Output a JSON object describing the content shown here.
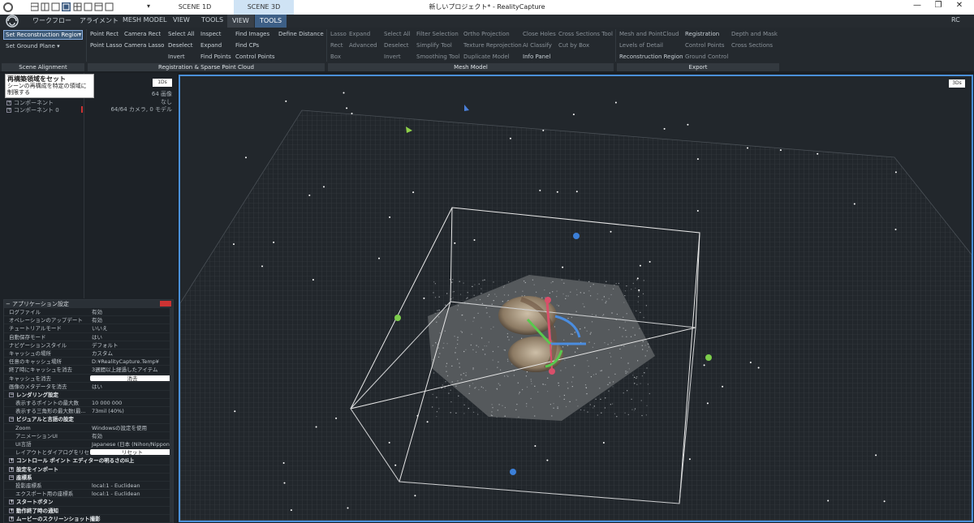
{
  "window": {
    "title": "新しいプロジェクト* - RealityCapture",
    "user": "RC",
    "minimize": "—",
    "maximize": "❐",
    "close": "✕"
  },
  "scene_tabs": [
    "SCENE 1D",
    "SCENE 3D"
  ],
  "menu": {
    "items": [
      "ワークフロー",
      "アライメント",
      "MESH MODEL",
      "VIEW",
      "TOOLS"
    ],
    "view": "VIEW",
    "tools": "TOOLS"
  },
  "ribbon": {
    "scene_alignment": {
      "caption": "Scene Alignment",
      "dropdown": "Set Reconstruction Region",
      "ground": "Set Ground Plane"
    },
    "registration": {
      "caption": "Registration & Sparse Point Cloud",
      "col1": [
        "Point Rect",
        "Point Lasso"
      ],
      "col2": [
        "Camera Rect",
        "Camera Lasso"
      ],
      "col3": [
        "Select All",
        "Deselect",
        "Invert"
      ],
      "col4": [
        "Inspect",
        "Expand",
        "Find Points"
      ],
      "col5": [
        "Find Images",
        "Find CPs",
        "Control Points"
      ],
      "col6": [
        "Define Distance"
      ]
    },
    "mesh": {
      "caption": "Mesh Model",
      "col1": [
        "Lasso",
        "Rect",
        "Box"
      ],
      "col2": [
        "Expand",
        "Advanced"
      ],
      "col3": [
        "Select All",
        "Deselect",
        "Invert"
      ],
      "col4": [
        "Filter Selection",
        "Simplify Tool",
        "Smoothing Tool"
      ],
      "col5": [
        "Ortho Projection",
        "Texture Reprojection",
        "Duplicate Model"
      ],
      "col6": [
        "Close Holes",
        "AI Classify",
        "Info Panel"
      ],
      "col7": [
        "Cross Sections Tool",
        "Cut by Box"
      ]
    },
    "export": {
      "caption": "Export",
      "col1": [
        "Mesh and PointCloud",
        "Levels of Detail",
        "Reconstruction Region"
      ],
      "col2": [
        "Registration",
        "Control Points",
        "Ground Control"
      ],
      "col3": [
        "Depth and Mask",
        "Cross Sections"
      ]
    }
  },
  "tooltip": {
    "title": "再構築領域をセット",
    "body": "シーンの再構成を特定の領域に制限する"
  },
  "tree": {
    "rows": [
      "コンポーネント",
      "コンポーネント 0"
    ]
  },
  "info": {
    "badge": "1Ds",
    "rows": [
      "64 画像",
      "なし",
      "64/64 カメラ, 0 モデル"
    ]
  },
  "settings": {
    "title": "アプリケーション設定",
    "rows": [
      {
        "k": "ログファイル",
        "v": "有効"
      },
      {
        "k": "オペレーションのアップデート",
        "v": "有効"
      },
      {
        "k": "チュートリアルモード",
        "v": "いいえ"
      },
      {
        "k": "自動保存モード",
        "v": "はい"
      },
      {
        "k": "ナビゲーションスタイル",
        "v": "デフォルト"
      },
      {
        "k": "キャッシュの場所",
        "v": "カスタム"
      },
      {
        "k": "任意のキャッシュ場所",
        "v": "D:¥RealityCapture.Temp¥"
      },
      {
        "k": "終了時にキャッシュを消去",
        "v": "3週間以上経過したアイテム"
      },
      {
        "k": "キャッシュを消去",
        "v": "消去",
        "btn": true
      },
      {
        "k": "画像のメタデータを消去",
        "v": "はい"
      },
      {
        "k": "レンダリング設定",
        "sec": true
      },
      {
        "k": "表示するポイントの最大数",
        "v": "10 000 000",
        "sub": true
      },
      {
        "k": "表示する三角形の最大数(最...",
        "v": "73mil (40%)",
        "sub": true
      },
      {
        "k": "ビジュアルと言語の設定",
        "sec": true
      },
      {
        "k": "Zoom",
        "v": "Windowsの設定を使用",
        "sub": true
      },
      {
        "k": "アニメーションUI",
        "v": "有効",
        "sub": true
      },
      {
        "k": "UI言語",
        "v": "Japanese (日本 (Nihon/Nippon))",
        "sub": true
      },
      {
        "k": "レイアウトとダイアログをリセット",
        "v": "リセット",
        "btn": true,
        "sub": true
      },
      {
        "k": "コントロール ポイント エディターの明るさのIi上",
        "sec": true
      },
      {
        "k": "設定をインポート",
        "sec": true
      },
      {
        "k": "座標系",
        "sec": true
      },
      {
        "k": "投影座標系",
        "v": "local:1 - Euclidean",
        "sub": true
      },
      {
        "k": "エクスポート用の座標系",
        "v": "local:1 - Euclidean",
        "sub": true
      },
      {
        "k": "スタートボタン",
        "sec": true
      },
      {
        "k": "動作終了時の通知",
        "sec": true
      },
      {
        "k": "ムービーのスクリーンショット撮影",
        "sec": true
      }
    ]
  },
  "viewport": {
    "badge": "3Ds",
    "accent": "#4a90d9"
  }
}
